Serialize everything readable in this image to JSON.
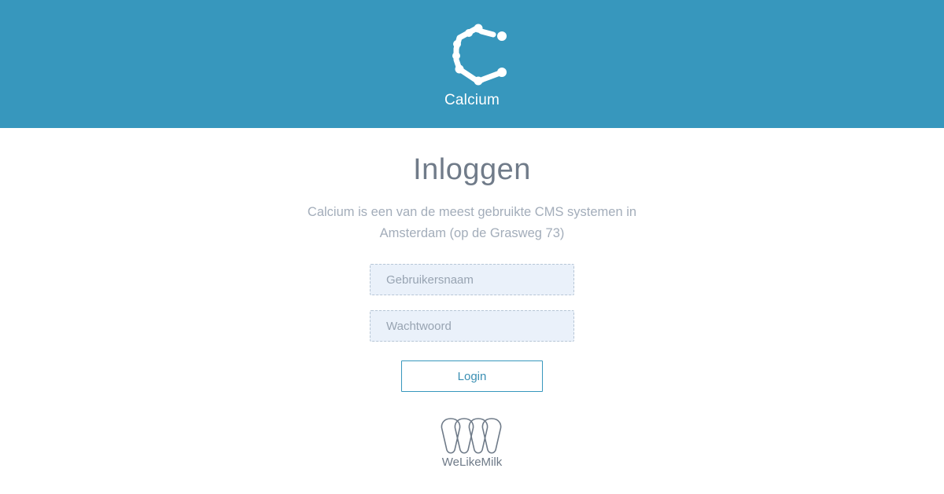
{
  "header": {
    "logo_icon": "calcium-molecule-c-icon",
    "app_name": "Calcium",
    "background_color": "#3797bd"
  },
  "login": {
    "title": "Inloggen",
    "description": "Calcium is een van de meest gebruikte CMS systemen in Amsterdam (op de Grasweg 73)",
    "username": {
      "placeholder": "Gebruikersnaam",
      "value": ""
    },
    "password": {
      "placeholder": "Wachtwoord",
      "value": ""
    },
    "submit_label": "Login"
  },
  "footer": {
    "brand_icon": "welikemilk-drops-icon",
    "brand_name": "WeLikeMilk"
  }
}
